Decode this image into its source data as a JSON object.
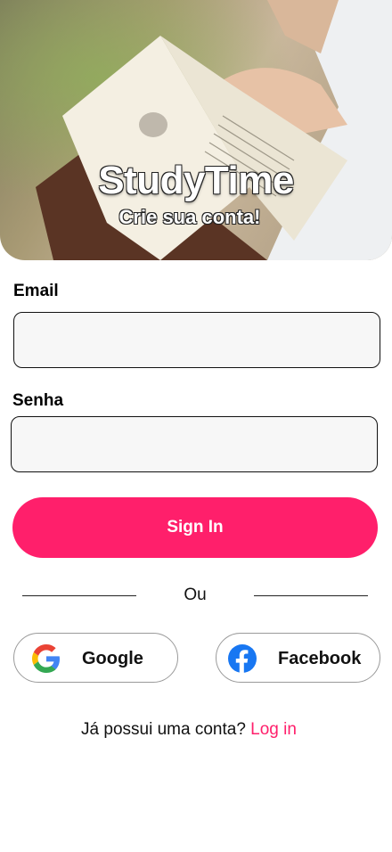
{
  "hero": {
    "title": "StudyTime",
    "subtitle": "Crie sua conta!"
  },
  "form": {
    "email_label": "Email",
    "email_value": "",
    "password_label": "Senha",
    "password_value": ""
  },
  "actions": {
    "sign_in_label": "Sign In",
    "divider_label": "Ou"
  },
  "social": {
    "google_label": "Google",
    "google_icon": "google-icon",
    "facebook_label": "Facebook",
    "facebook_icon": "facebook-icon"
  },
  "footer": {
    "prompt": "Já possui uma conta? ",
    "login_link": "Log in"
  },
  "colors": {
    "accent": "#ff1f6b",
    "facebook_blue": "#1877f2",
    "input_bg": "#f7f7f7"
  }
}
